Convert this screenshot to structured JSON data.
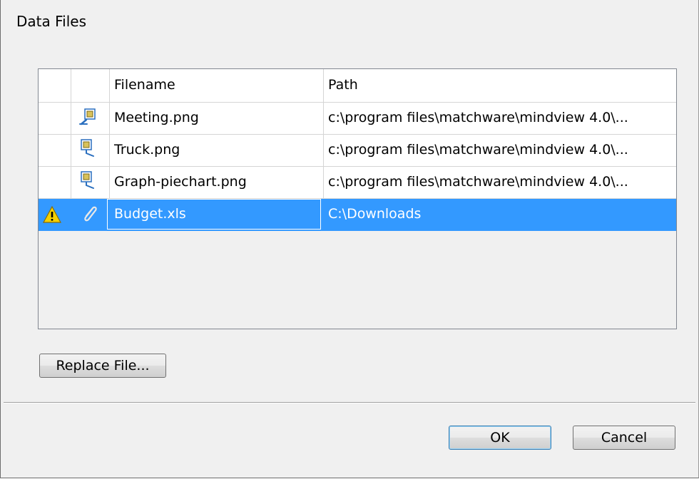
{
  "dialog": {
    "title": "Data Files"
  },
  "table": {
    "columns": [
      "",
      "",
      "Filename",
      "Path"
    ],
    "rows": [
      {
        "status_icon": "",
        "type_icon": "image-file-icon",
        "filename": "Meeting.png",
        "path": "c:\\program files\\matchware\\mindview 4.0\\...",
        "selected": false
      },
      {
        "status_icon": "",
        "type_icon": "image-file-icon",
        "filename": "Truck.png",
        "path": "c:\\program files\\matchware\\mindview 4.0\\...",
        "selected": false
      },
      {
        "status_icon": "",
        "type_icon": "image-file-icon",
        "filename": "Graph-piechart.png",
        "path": "c:\\program files\\matchware\\mindview 4.0\\...",
        "selected": false
      },
      {
        "status_icon": "warning-icon",
        "type_icon": "paperclip-icon",
        "filename": "Budget.xls",
        "path": "C:\\Downloads",
        "selected": true
      }
    ]
  },
  "buttons": {
    "replace": "Replace File...",
    "ok": "OK",
    "cancel": "Cancel"
  },
  "colors": {
    "selection": "#3399ff",
    "warning": "#f5d000"
  }
}
